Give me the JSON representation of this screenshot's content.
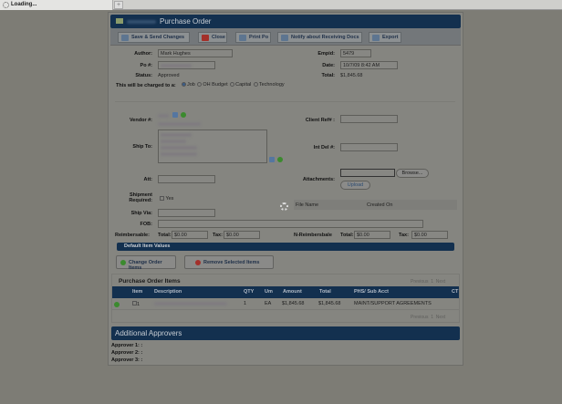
{
  "browser": {
    "tab_title": "Loading...",
    "new_tab": "+"
  },
  "header": {
    "title": "Purchase Order"
  },
  "toolbar": {
    "save": "Save & Send Changes",
    "close": "Close",
    "print": "Print Po",
    "notify": "Notify about Receiving Docs",
    "export": "Export"
  },
  "form": {
    "author_label": "Author:",
    "author": "Mark Hughes",
    "empid_label": "Empid:",
    "empid": "5479",
    "po_label": "Po #:",
    "date_label": "Date:",
    "date": "10/7/09 8:42 AM",
    "status_label": "Status:",
    "status": "Approved",
    "total_label": "Total:",
    "total": "$1,845.68",
    "charged_label": "This will be charged to a:",
    "charge_options": [
      "Job",
      "OH Budget",
      "Capital",
      "Technology"
    ],
    "charge_selected": "Job",
    "vendor_label": "Vendor #:",
    "client_ref_label": "Client Ref# :",
    "ship_to_label": "Ship To:",
    "int_del_label": "Int Del #:",
    "att_label": "Att:",
    "attachments_label": "Attachments:",
    "browse": "Browse...",
    "upload": "Upload",
    "shipment_label_1": "Shipment",
    "shipment_label_2": "Required:",
    "shipment_yes": "Yes",
    "file_name_col": "File Name",
    "created_on_col": "Created On",
    "ship_via_label": "Ship Via:",
    "fob_label": "FOB:",
    "reimb_label": "Reimbersable:",
    "reimb_total_label": "Total:",
    "reimb_total": "$0.00",
    "reimb_tax_label": "Tax:",
    "reimb_tax": "$0.00",
    "nreimb_label": "N-Reimbersbale",
    "nreimb_total_label": "Total:",
    "nreimb_total": "$0.00",
    "nreimb_tax_label": "Tax:",
    "nreimb_tax": "$0.00",
    "default_item_values": "Default Item Values"
  },
  "items": {
    "change_button": "Change Order Items",
    "remove_button": "Remove Selected Items",
    "title": "Purchase Order Items",
    "paging": {
      "previous": "Previous",
      "page": "1",
      "next": "Next"
    },
    "columns": [
      "Item",
      "Description",
      "QTY",
      "Um",
      "Amount",
      "Total",
      "PHS/ Sub Acct",
      "CT"
    ],
    "rows": [
      {
        "item": "1",
        "qty": "1",
        "um": "EA",
        "amount": "$1,845.68",
        "total": "$1,845.68",
        "phs": "MAINT/SUPPORT AGREEMENTS"
      }
    ]
  },
  "approvers": {
    "title": "Additional Approvers",
    "lines": [
      "Approver 1: :",
      "Approver 2: :",
      "Approver 3: :"
    ]
  },
  "colors": {
    "header": "#13304f",
    "overlay_bg": "#7d7c75"
  }
}
